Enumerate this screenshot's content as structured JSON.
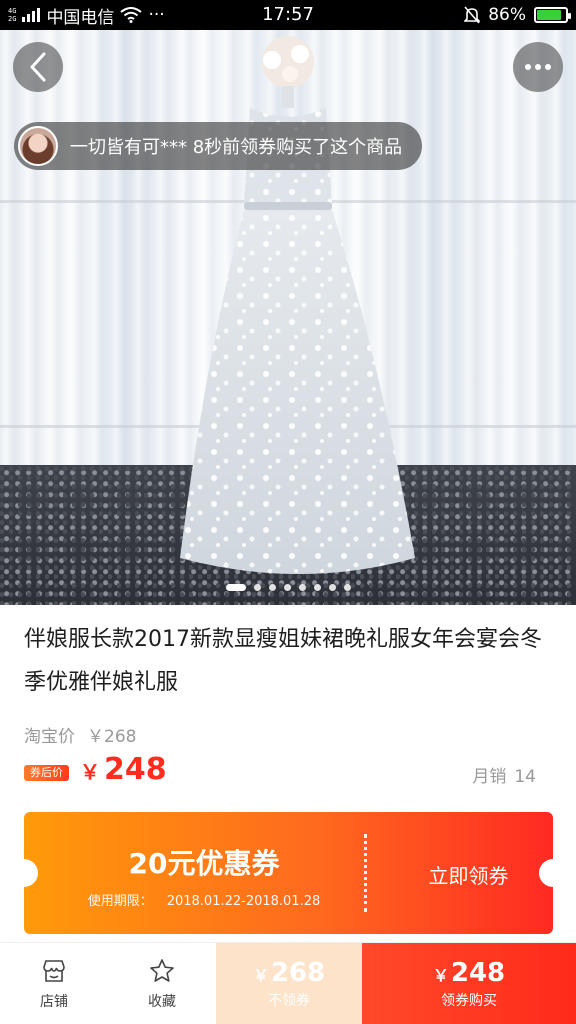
{
  "status_bar": {
    "network_tags": [
      "4G",
      "2G"
    ],
    "carrier": "中国电信",
    "extra": "···",
    "time": "17:57",
    "battery_pct": "86%",
    "battery_level": 0.86
  },
  "hero": {
    "image_slide_count": 8,
    "active_slide": 0
  },
  "buy_notice": {
    "text": "一切皆有可*** 8秒前领券购买了这个商品"
  },
  "product": {
    "title": "伴娘服长款2017新款显瘦姐妹裙晚礼服女年会宴会冬季优雅伴娘礼服",
    "orig_label": "淘宝价",
    "orig_price": "￥268",
    "coupon_tag": "券后价",
    "currency": "￥",
    "price": "248",
    "monthly_label": "月销",
    "monthly_sales": "14"
  },
  "coupon": {
    "value": "20元优惠券",
    "period_label": "使用期限：",
    "period_dates": "2018.01.22-2018.01.28",
    "action": "立即领券"
  },
  "bottom_bar": {
    "store_label": "店铺",
    "fav_label": "收藏",
    "no_coupon_currency": "￥",
    "no_coupon_price": "268",
    "no_coupon_label": "不领券",
    "buy_currency": "￥",
    "buy_price": "248",
    "buy_label": "领券购买"
  },
  "colors": {
    "accent": "#ff2d1f",
    "coupon_start": "#ff9a0a",
    "coupon_end": "#ff2a22",
    "no_coupon_bg": "#fde3c9"
  }
}
